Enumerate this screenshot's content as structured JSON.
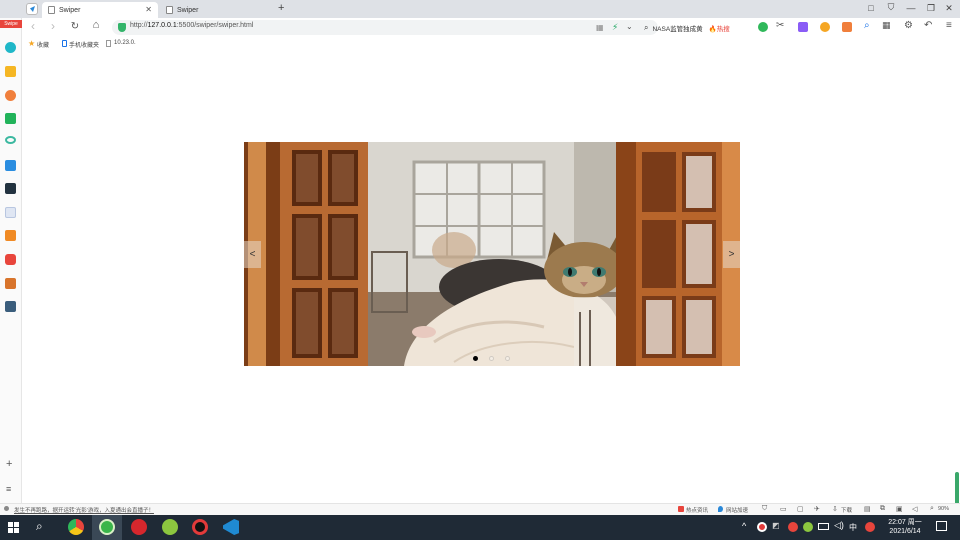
{
  "tabs": [
    {
      "title": "Swiper",
      "active": true
    },
    {
      "title": "Swiper",
      "active": false
    }
  ],
  "new_tab_label": "+",
  "window_buttons": [
    "□",
    "—",
    "❐",
    "✕"
  ],
  "toolbar": {
    "back_label": "‹",
    "forward_label": "›",
    "reload_label": "↻",
    "home_label": "⌂",
    "url_prefix": "http://",
    "url_host": "127.0.0.1",
    "url_rest": ":5500/swiper/swiper.html",
    "search_text": "NASA监管独成黄",
    "hot_label": "热搜"
  },
  "bookmarks": {
    "star_label": "收藏",
    "items": [
      "手机收藏夹",
      "10.23.0."
    ]
  },
  "sidebar": {
    "add_label": "+",
    "menu_label": "≡",
    "badge_label": "Swipe"
  },
  "slider": {
    "prev_label": "<",
    "next_label": ">",
    "slide_count": 3,
    "active_index": 0
  },
  "status": {
    "left_text": "发生不再跑路，据开运转‘光影’游戏，入夏通出会直播子！",
    "hot_news": "热点资讯",
    "accel": "网站加速",
    "download": "下载",
    "zoom": "90%"
  },
  "taskbar": {
    "time": "22:07 周一",
    "date": "2021/6/14",
    "ime_label": "中"
  },
  "colors": {
    "accent": "#1a73e8",
    "taskbar": "#1f2a36",
    "hot": "#e8453c"
  }
}
